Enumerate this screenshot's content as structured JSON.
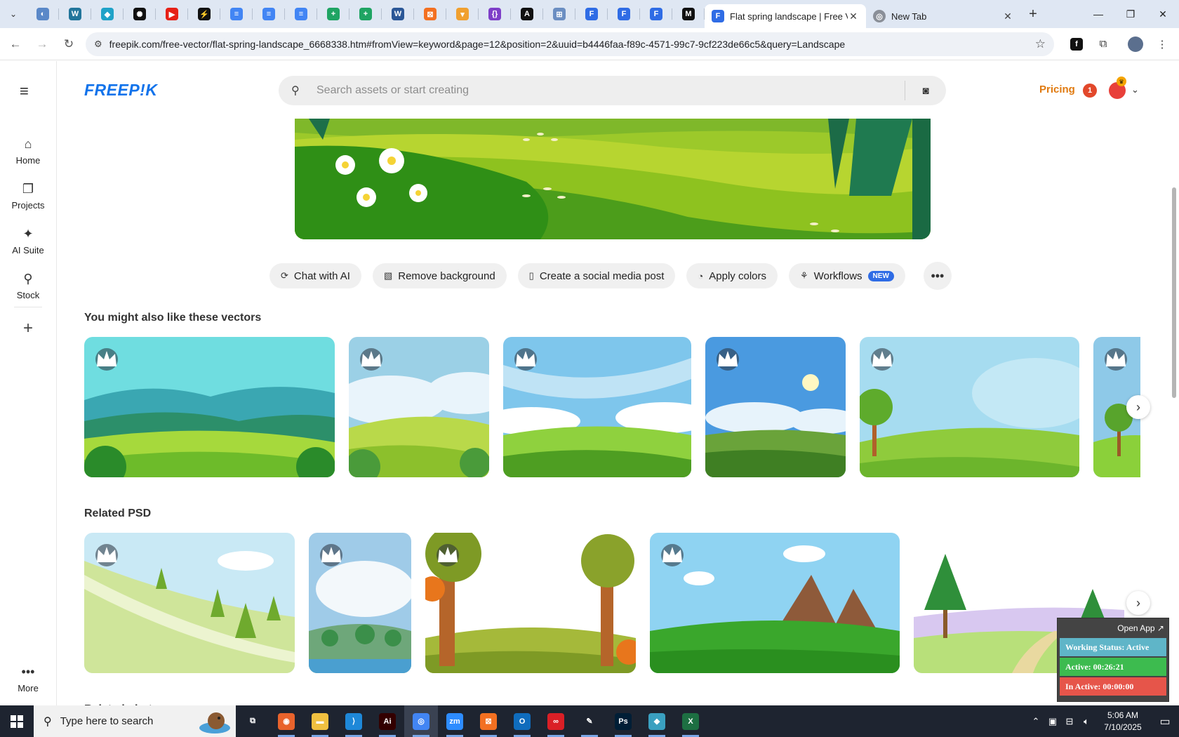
{
  "browser": {
    "pinned_tabs": [
      {
        "icon": "globe-icon",
        "color": "#5a88c8",
        "glyph": "◐"
      },
      {
        "icon": "wordpress-icon",
        "color": "#21759b",
        "glyph": "W"
      },
      {
        "icon": "streamline-icon",
        "color": "#1fa2c8",
        "glyph": "◆"
      },
      {
        "icon": "openai-icon",
        "color": "#111111",
        "glyph": "✺"
      },
      {
        "icon": "youtube-icon",
        "color": "#e62117",
        "glyph": "▶"
      },
      {
        "icon": "bolt-icon",
        "color": "#111111",
        "glyph": "⚡"
      },
      {
        "icon": "docs-icon",
        "color": "#4285f4",
        "glyph": "≡"
      },
      {
        "icon": "docs-icon",
        "color": "#4285f4",
        "glyph": "≡"
      },
      {
        "icon": "docs-icon",
        "color": "#4285f4",
        "glyph": "≡"
      },
      {
        "icon": "sheets-icon",
        "color": "#1fa463",
        "glyph": "+"
      },
      {
        "icon": "sheets-icon",
        "color": "#1fa463",
        "glyph": "+"
      },
      {
        "icon": "word-icon",
        "color": "#2b5797",
        "glyph": "W"
      },
      {
        "icon": "xampp-icon",
        "color": "#f37021",
        "glyph": "⊠"
      },
      {
        "icon": "feather-icon",
        "color": "#f0a030",
        "glyph": "▾"
      },
      {
        "icon": "code-icon",
        "color": "#7e3fc8",
        "glyph": "{}"
      },
      {
        "icon": "api-icon",
        "color": "#111111",
        "glyph": "A"
      },
      {
        "icon": "grid-icon",
        "color": "#6b8ec2",
        "glyph": "⊞"
      },
      {
        "icon": "forms-icon",
        "color": "#2f6ce5",
        "glyph": "F"
      },
      {
        "icon": "forms-icon",
        "color": "#2f6ce5",
        "glyph": "F"
      },
      {
        "icon": "forms-icon",
        "color": "#2f6ce5",
        "glyph": "F"
      },
      {
        "icon": "medium-icon",
        "color": "#111111",
        "glyph": "M"
      }
    ],
    "active_tab": {
      "title": "Flat spring landscape | Free Vector",
      "icon": "freepik-favicon-icon",
      "color": "#2f6ce5"
    },
    "other_tab": {
      "title": "New Tab",
      "icon": "chrome-icon"
    },
    "url": "freepik.com/free-vector/flat-spring-landscape_6668338.htm#fromView=keyword&page=12&position=2&uuid=b4446faa-f89c-4571-99c7-9cf223de66c5&query=Landscape"
  },
  "sidebar": {
    "items": [
      {
        "label": "Home",
        "icon": "home-icon",
        "glyph": "⌂"
      },
      {
        "label": "Projects",
        "icon": "projects-icon",
        "glyph": "❐"
      },
      {
        "label": "AI Suite",
        "icon": "sparkle-icon",
        "glyph": "✦"
      },
      {
        "label": "Stock",
        "icon": "shapes-icon",
        "glyph": "⚲"
      }
    ],
    "more_label": "More"
  },
  "header": {
    "logo": "FREEP!K",
    "search_placeholder": "Search assets or start creating",
    "pricing": "Pricing",
    "notification_count": "1"
  },
  "actions": [
    {
      "label": "Chat with AI",
      "icon": "chat-ai-icon",
      "glyph": "⟳"
    },
    {
      "label": "Remove background",
      "icon": "remove-bg-icon",
      "glyph": "▧"
    },
    {
      "label": "Create a social media post",
      "icon": "phone-icon",
      "glyph": "▯"
    },
    {
      "label": "Apply colors",
      "icon": "palette-icon",
      "glyph": "◔"
    },
    {
      "label": "Workflows",
      "icon": "workflow-icon",
      "glyph": "⚘",
      "badge": "NEW"
    }
  ],
  "sections": {
    "vectors_title": "You might also like these vectors",
    "psd_title": "Related PSD",
    "photos_title": "Related photos"
  },
  "tracker": {
    "open_app": "Open App ↗",
    "status": "Working Status: Active",
    "active": "Active: 00:26:21",
    "inactive": "In Active: 00:00:00"
  },
  "taskbar": {
    "search_placeholder": "Type here to search",
    "apps": [
      {
        "icon": "task-view-icon",
        "color": "#1e2430",
        "glyph": "⧉"
      },
      {
        "icon": "firefox-icon",
        "color": "#e8632c",
        "glyph": "◉"
      },
      {
        "icon": "file-explorer-icon",
        "color": "#f0c040",
        "glyph": "▬"
      },
      {
        "icon": "vscode-icon",
        "color": "#1e88d8",
        "glyph": "⟩"
      },
      {
        "icon": "illustrator-icon",
        "color": "#330000",
        "glyph": "Ai"
      },
      {
        "icon": "chrome-icon",
        "color": "#4285f4",
        "glyph": "◎"
      },
      {
        "icon": "zoom-icon",
        "color": "#2d8cff",
        "glyph": "zm"
      },
      {
        "icon": "xampp-icon",
        "color": "#f37021",
        "glyph": "⊠"
      },
      {
        "icon": "outlook-icon",
        "color": "#0f6cbd",
        "glyph": "O"
      },
      {
        "icon": "creative-cloud-icon",
        "color": "#da1f26",
        "glyph": "∞"
      },
      {
        "icon": "pen-tool-icon",
        "color": "#1e2430",
        "glyph": "✎"
      },
      {
        "icon": "photoshop-icon",
        "color": "#001e36",
        "glyph": "Ps"
      },
      {
        "icon": "app-diamond-icon",
        "color": "#3aa0c0",
        "glyph": "◆"
      },
      {
        "icon": "excel-icon",
        "color": "#1d6f42",
        "glyph": "X"
      }
    ],
    "time": "5:06 AM",
    "date": "7/10/2025"
  }
}
